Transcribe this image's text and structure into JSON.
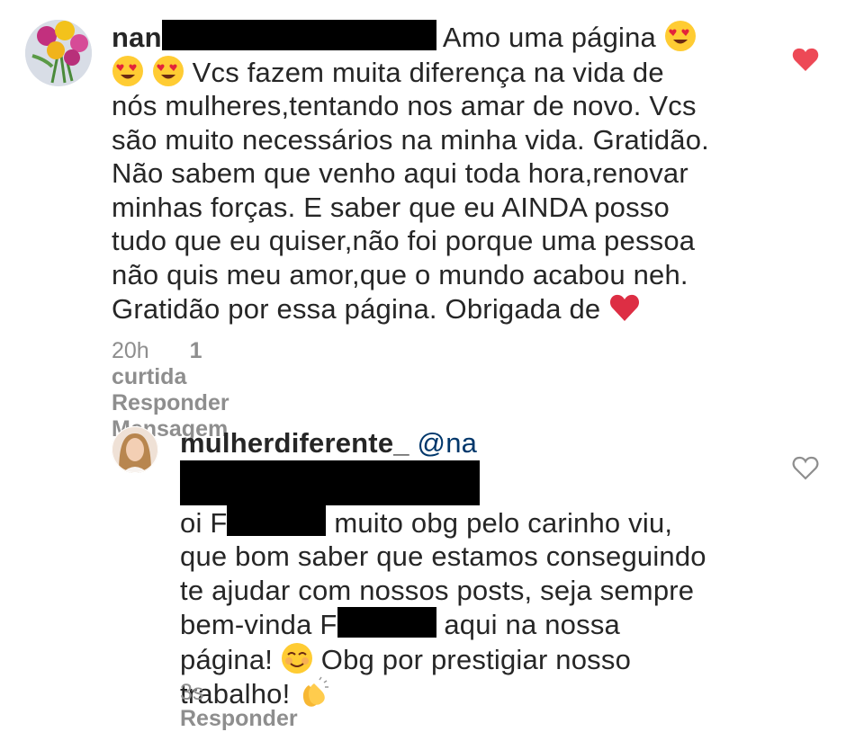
{
  "comments": [
    {
      "username": "nan",
      "text_lines": [
        "Amo uma página",
        "Vcs fazem muita diferença na vida de",
        "nós mulheres,tentando nos amar de novo. Vcs",
        "são muito necessários na minha vida. Gratidão.",
        "Não sabem que venho aqui toda hora,renovar",
        "minhas forças. E saber que eu AINDA posso",
        "tudo que eu quiser,não foi porque uma pessoa",
        "não quis meu amor,que o mundo acabou neh.",
        "Gratidão por essa página. Obrigada de"
      ],
      "time": "20h",
      "likes": "1 curtida",
      "reply_label": "Responder",
      "message_label": "Mensagem",
      "liked": true,
      "like_color": "#ed4956"
    },
    {
      "username": "mulherdiferente_",
      "mention": "@na",
      "text_lines": [
        "oi F",
        "muito obg pelo carinho viu,",
        "que bom saber que estamos conseguindo",
        "te ajudar com nossos posts, seja sempre",
        "bem-vinda F",
        "aqui na nossa",
        "página!",
        "Obg por prestigiar nosso",
        "trabalho!"
      ],
      "time": "3s",
      "reply_label": "Responder",
      "liked": false
    }
  ],
  "icons": [
    "heart-filled-icon",
    "heart-outline-icon",
    "heart-eyes-emoji",
    "smiling-blush-emoji",
    "clapping-hands-emoji",
    "red-heart-emoji"
  ]
}
